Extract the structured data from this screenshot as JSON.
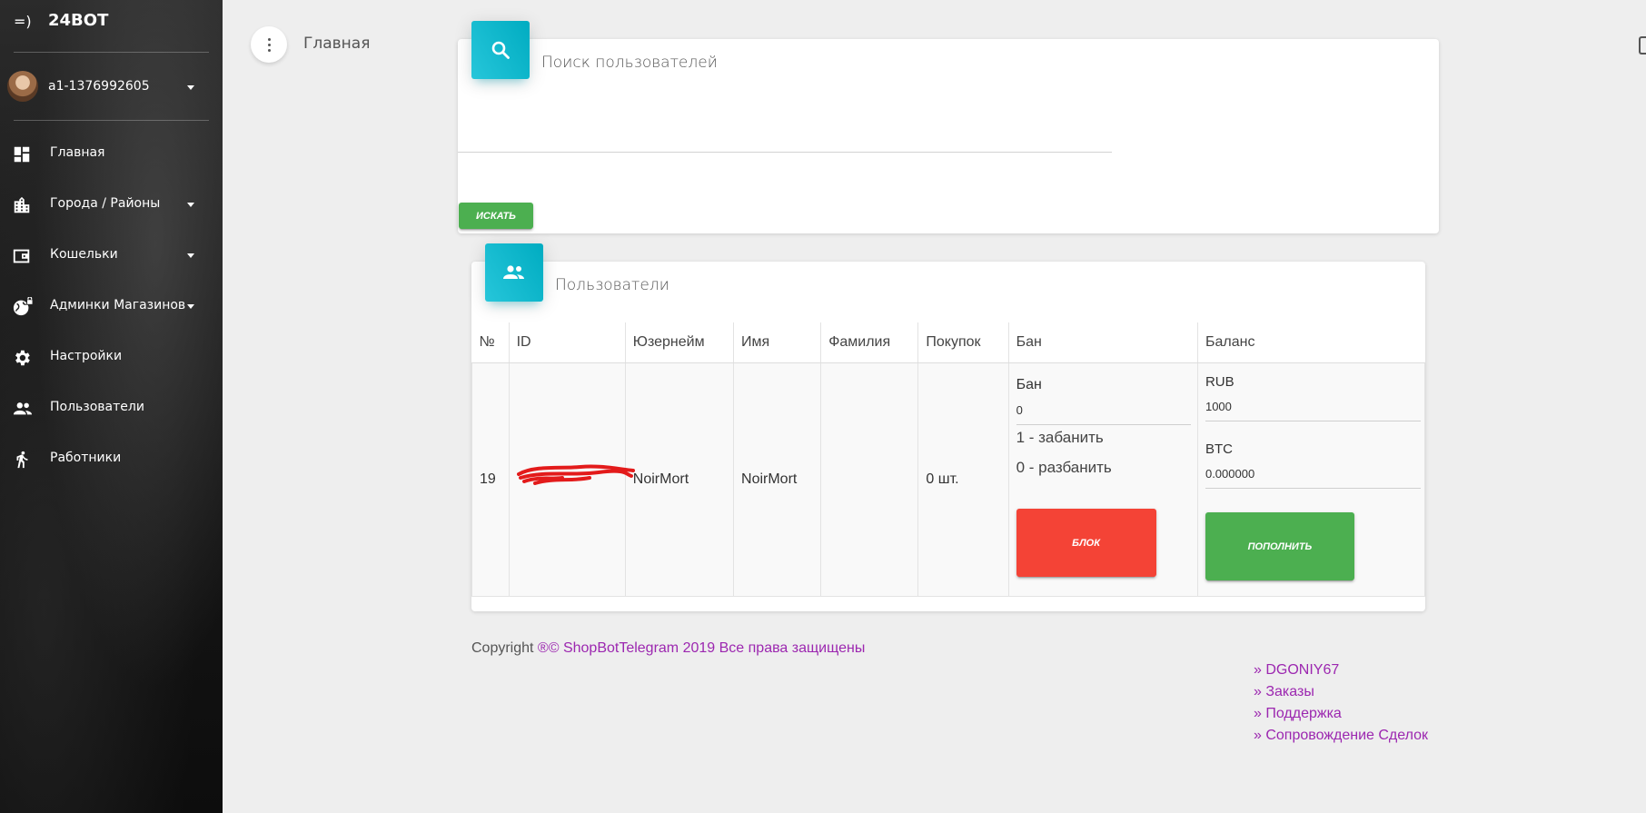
{
  "brand": {
    "mini": "=)",
    "name": "24BOT"
  },
  "user": {
    "name": "a1-1376992605"
  },
  "sidebar": {
    "items": [
      {
        "label": "Главная",
        "icon": "dashboard-icon"
      },
      {
        "label": "Города / Районы",
        "icon": "city-icon"
      },
      {
        "label": "Кошельки",
        "icon": "wallet-icon"
      },
      {
        "label": "Админки Магазинов",
        "icon": "globe-lock-icon"
      },
      {
        "label": "Настройки",
        "icon": "gear-icon"
      },
      {
        "label": "Пользователи",
        "icon": "people-icon"
      },
      {
        "label": "Работники",
        "icon": "runner-icon"
      }
    ]
  },
  "header": {
    "title": "Главная"
  },
  "search_card": {
    "title": "Поиск пользователей",
    "input_value": "",
    "button_label": "ИСКАТЬ"
  },
  "users_card": {
    "title": "Пользователи",
    "columns": [
      "№",
      "ID",
      "Юзернейм",
      "Имя",
      "Фамилия",
      "Покупок",
      "Бан",
      "Баланс"
    ],
    "rows": [
      {
        "num": "19",
        "id": "",
        "username": "NoirMort",
        "first_name": "NoirMort",
        "last_name": "",
        "purchases": "0 шт.",
        "ban": {
          "label": "Бан",
          "value": "0",
          "hint_ban": "1 - забанить",
          "hint_unban": "0 - разбанить",
          "button_label": "БЛОК"
        },
        "balance": {
          "rub_label": "RUB",
          "rub_value": "1000",
          "btc_label": "BTC",
          "btc_value": "0.000000",
          "button_label": "ПОПОЛНИТЬ"
        }
      }
    ]
  },
  "footer": {
    "copyright_prefix": "Copyright ",
    "copyright_link": "®© ShopBotTelegram 2019 Все права защищены",
    "links": [
      "» DGONIY67",
      "» Заказы",
      "» Поддержка",
      "» Сопровождение Сделок"
    ]
  },
  "colors": {
    "accent_cyan": "#00acc1",
    "success": "#4caf50",
    "danger": "#f44336",
    "link": "#9c27b0"
  }
}
